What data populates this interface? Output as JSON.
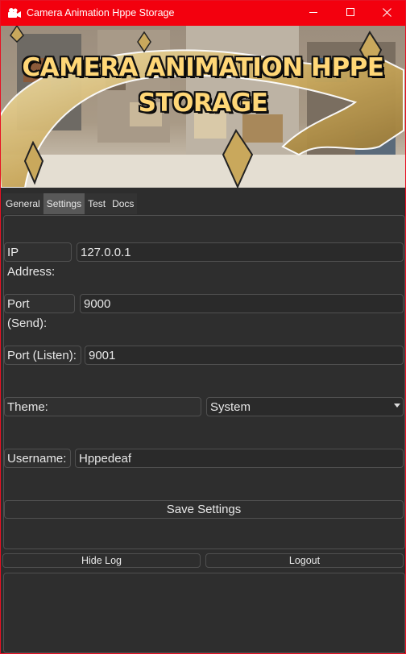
{
  "window": {
    "title": "Camera Animation Hppe Storage",
    "accent": "#f3000e"
  },
  "banner": {
    "title_line1": "CAMERA ANIMATION HPPE",
    "title_line2": "STORAGE"
  },
  "tabs": [
    {
      "label": "General",
      "active": false
    },
    {
      "label": "Settings",
      "active": true
    },
    {
      "label": "Test",
      "active": false
    },
    {
      "label": "Docs",
      "active": false
    }
  ],
  "settings": {
    "ip": {
      "label": "IP Address:",
      "value": "127.0.0.1"
    },
    "port_send": {
      "label": "Port (Send):",
      "value": "9000"
    },
    "port_listen": {
      "label": "Port (Listen):",
      "value": "9001"
    },
    "theme": {
      "label": "Theme:",
      "value": "System"
    },
    "username": {
      "label": "Username:",
      "value": "Hppedeaf"
    },
    "save_label": "Save Settings"
  },
  "footer": {
    "hide_log_label": "Hide Log",
    "logout_label": "Logout"
  },
  "icons": {
    "app": "camera-icon",
    "minimize": "minimize-icon",
    "maximize": "maximize-icon",
    "close": "close-icon",
    "dropdown": "chevron-down-icon"
  }
}
